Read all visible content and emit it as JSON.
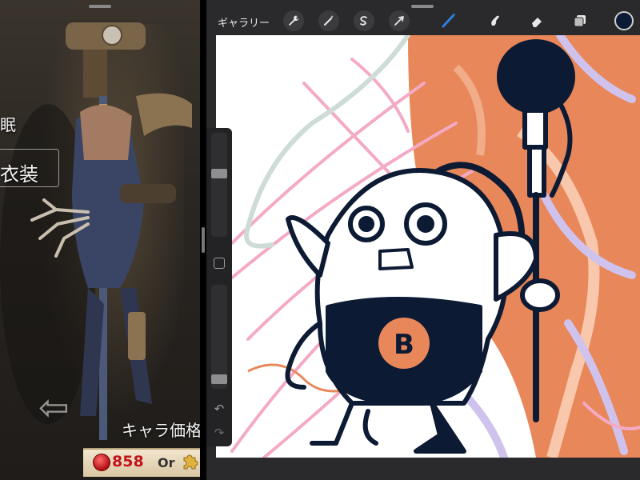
{
  "game_screen": {
    "labels": {
      "sleep_text": "眠",
      "costume_text": "衣装",
      "chara_price_text": "キャラ価格"
    },
    "price": {
      "value": "858",
      "or_text": "Or"
    },
    "icons": {
      "coin": "red-coin-icon",
      "puzzle": "puzzle-piece-icon",
      "arrow": "left-arrow-icon"
    }
  },
  "procreate": {
    "toolbar": {
      "gallery_label": "ギャラリー",
      "tools": [
        {
          "name": "actions",
          "icon": "wrench-icon"
        },
        {
          "name": "adjustments",
          "icon": "magic-wand-icon"
        },
        {
          "name": "selection",
          "icon": "selection-s-icon"
        },
        {
          "name": "transform",
          "icon": "arrow-cursor-icon"
        },
        {
          "name": "brush",
          "icon": "brush-icon"
        },
        {
          "name": "smudge",
          "icon": "smudge-finger-icon"
        },
        {
          "name": "eraser",
          "icon": "eraser-icon"
        },
        {
          "name": "layers",
          "icon": "layers-icon"
        }
      ],
      "active_tool": "brush",
      "current_color": "#0d1a33"
    },
    "sidebar": {
      "size_level": 0.62,
      "opacity_level": 0.05,
      "undo_icon": "undo-icon",
      "redo_icon": "redo-icon"
    },
    "canvas": {
      "character_letter": "B"
    },
    "colors": {
      "ink": "#0d1a33",
      "orange": "#e8875a",
      "pink": "#f4a9c4",
      "lavender": "#cfc3ee",
      "sage": "#cfdcd6",
      "accent_blue": "#2f7fe0"
    }
  }
}
